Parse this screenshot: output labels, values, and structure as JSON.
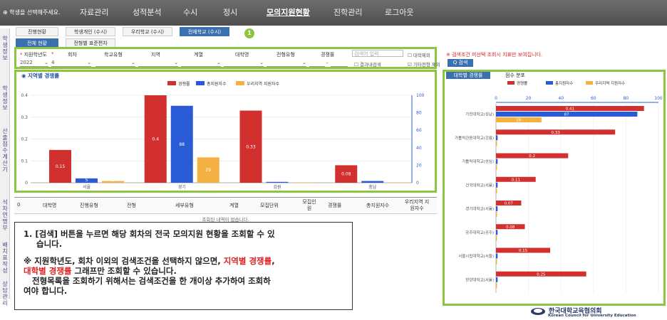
{
  "topnav": {
    "select_label": "학생을 선택해주세요.",
    "menus": [
      "자료관리",
      "성적분석",
      "수시",
      "정시",
      "모의지원현황",
      "진학관리",
      "로그아웃"
    ],
    "active_index": 4
  },
  "sidebar": {
    "tabs": [
      "학생정보",
      "학생정보",
      "산출점수계산기",
      "석차연명부",
      "배치표작성",
      "상담관리"
    ]
  },
  "tabs": {
    "row1": [
      "진행현황",
      "학생개인 (수시)",
      "우리학교 (수시)",
      "전체학교 (수시)"
    ],
    "row2": [
      "전체 현황",
      "전형별 표준편차"
    ],
    "step_badge": "1"
  },
  "filters": {
    "labels": [
      "지원학년도",
      "회차",
      "학교유형",
      "지역",
      "계열",
      "대학명",
      "전형유형",
      "경쟁률"
    ],
    "year_value": "2022",
    "round_value": "4",
    "search_placeholder": "검색어 입력",
    "check_other_univ": "대학제외",
    "check_recent": "결과내검색",
    "check_other_period": "기타전형 제외",
    "notice": "※ 검색조건 미선택 조회시 지표만 보여집니다.",
    "search_button": "Q 검색"
  },
  "left_chart": {
    "title": "지역별 경쟁률",
    "legend": [
      "경쟁률",
      "총지원자수",
      "우리지역 지원자수"
    ],
    "colors": [
      "#d22f2f",
      "#2a5bd7",
      "#f5b042"
    ],
    "chart_data": {
      "type": "bar",
      "title": "지역별 경쟁률",
      "categories": [
        "서울",
        "경기",
        "강원",
        "충남"
      ],
      "series": [
        {
          "name": "경쟁률",
          "values": [
            0.15,
            0.4,
            0.33,
            0.08
          ]
        },
        {
          "name": "총지원자수",
          "values": [
            5,
            88,
            1,
            2
          ]
        },
        {
          "name": "우리지역 지원자수",
          "values": [
            2,
            29,
            0,
            0
          ]
        }
      ],
      "bar_labels": [
        [
          "0.15",
          "0.4",
          "0.33",
          "0.08"
        ],
        [
          "5",
          "88",
          "",
          ""
        ],
        [
          "2",
          "29",
          "0",
          "0"
        ]
      ],
      "ylim_left": [
        0,
        0.4
      ],
      "ylim_right": [
        0,
        100
      ],
      "left_ticks": [
        "0",
        "0.1",
        "0.2",
        "0.3",
        "0.4"
      ],
      "right_ticks": [
        "0",
        "20",
        "40",
        "60",
        "80",
        "100"
      ]
    }
  },
  "right_chart": {
    "tabs": [
      "대학별 경쟁률",
      "점수 분포"
    ],
    "legend": [
      "경쟁률",
      "총지원자수",
      "우리지역 지원자수"
    ],
    "chart_data": {
      "type": "bar",
      "title": "대학별 경쟁률",
      "orientation": "horizontal",
      "categories": [
        "가천대학교(성남)",
        "가톨릭관동대학교(강릉)",
        "가톨릭대학교(성심)",
        "건국대학교(서울)",
        "경기대학교(서울)",
        "공주대학교(공주)",
        "서울시립대학교(서울)",
        "한양대학교(서울)"
      ],
      "series": [
        {
          "name": "경쟁률",
          "values": [
            0.41,
            0.33,
            0.2,
            0.11,
            0.07,
            0.08,
            0.15,
            0.25
          ]
        },
        {
          "name": "총지원자수",
          "values": [
            87,
            1,
            1,
            1,
            1,
            1,
            1,
            1
          ]
        },
        {
          "name": "우리지역 지원자수",
          "values": [
            28,
            0,
            0,
            0,
            0,
            0,
            0,
            0
          ]
        }
      ],
      "bar_labels": [
        [
          "0.41",
          "0.33",
          "0.2",
          "0.11",
          "0.07",
          "0.08",
          "0.15",
          "0.25"
        ],
        [
          "87",
          "",
          "",
          "",
          "",
          "",
          "",
          ""
        ],
        [
          "28",
          "",
          "",
          "",
          "",
          "",
          "",
          ""
        ]
      ],
      "xlim": [
        0,
        100
      ],
      "top_ticks": [
        "0",
        "20",
        "40",
        "60",
        "80",
        "100"
      ]
    }
  },
  "table": {
    "columns": [
      "0",
      "대학명",
      "진행유형",
      "전형",
      "세부유형",
      "계열",
      "모집단위",
      "모집인원",
      "경쟁률",
      "총지원자수",
      "우리지역 지원자수"
    ],
    "empty_message": "조회된 내역이 없습니다."
  },
  "callout": {
    "line1": "1.  [검색] 버튼을 누르면 해당 회차의 전국 모의지원 현황을 조회할 수 있",
    "line2": "습니다.",
    "line3a": "※   지원학년도, 회차 이외의 검색조건을 선택하지 않으면, ",
    "line3b": "지역별 경쟁률",
    "line3c": ",",
    "line4a": "대학별 경쟁률",
    "line4b": " 그래프만 조회할 수 있습니다.",
    "line5": "전형목록을 조회하기 위해서는 검색조건을 한 개이상 추가하여 조회하",
    "line6": "여야 합니다."
  },
  "footer": {
    "org_name": "한국대학교육협의회",
    "org_name_en": "Korean Council for University Education"
  }
}
